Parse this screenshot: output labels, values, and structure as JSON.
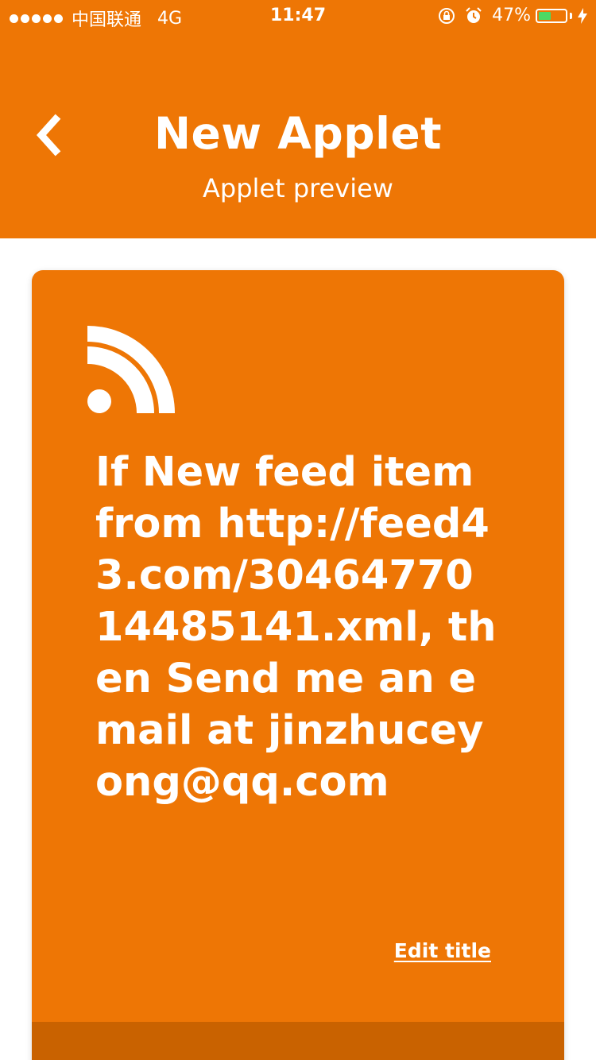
{
  "status_bar": {
    "carrier": "中国联通",
    "network": "4G",
    "time": "11:47",
    "battery_percent": "47%",
    "battery_level": 0.47,
    "icons": [
      "signal-dots-icon",
      "orientation-lock-icon",
      "alarm-icon",
      "battery-icon",
      "charging-bolt-icon"
    ]
  },
  "header": {
    "title": "New Applet",
    "subtitle": "Applet preview",
    "back_icon": "chevron-left-icon"
  },
  "card": {
    "icon": "rss-feed-icon",
    "title": "If New feed item from http://feed43.com/3046477014485141.xml, then Send me an email at jinzhuceyong@qq.com",
    "edit_label": "Edit title"
  },
  "colors": {
    "brand_orange": "#EE7605",
    "footer_orange": "#C96200",
    "battery_green": "#4CD964",
    "text": "#FFFFFF"
  }
}
